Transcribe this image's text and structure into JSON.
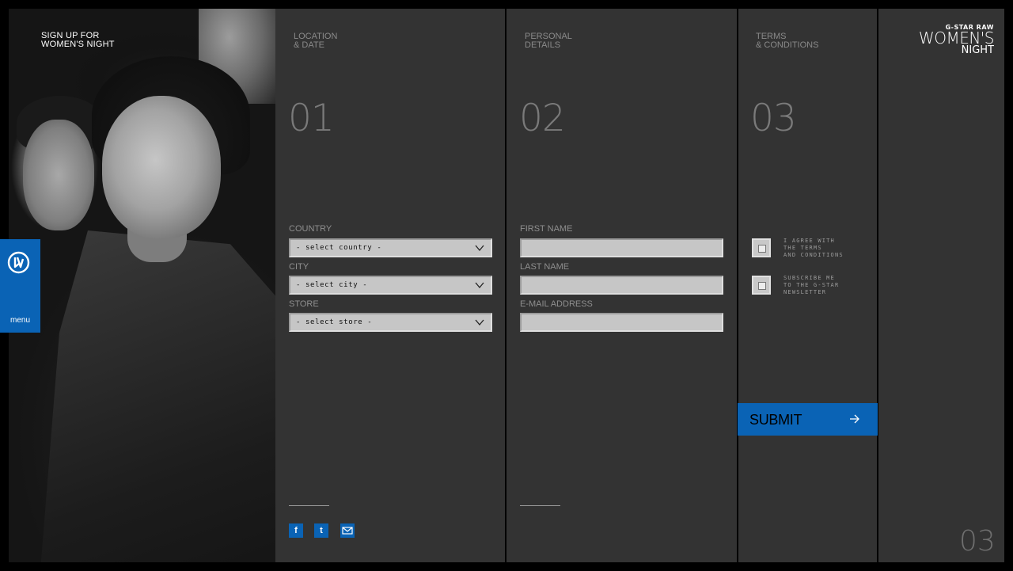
{
  "photo_panel": {
    "title_line1": "SIGN UP FOR",
    "title_line2": "WOMEN'S NIGHT"
  },
  "menu": {
    "label": "menu",
    "icon": "g-star-logo-icon",
    "color": "#0a63b5"
  },
  "steps": [
    {
      "head_line1": "LOCATION",
      "head_line2": "& DATE",
      "number": "01"
    },
    {
      "head_line1": "PERSONAL",
      "head_line2": "DETAILS",
      "number": "02"
    },
    {
      "head_line1": "TERMS",
      "head_line2": "& CONDITIONS",
      "number": "03"
    }
  ],
  "location": {
    "country_label": "COUNTRY",
    "country_value": "- select country -",
    "city_label": "CITY",
    "city_value": "- select city -",
    "store_label": "STORE",
    "store_value": "- select store -"
  },
  "personal": {
    "first_name_label": "FIRST NAME",
    "first_name_value": "",
    "last_name_label": "LAST NAME",
    "last_name_value": "",
    "email_label": "E-MAIL ADDRESS",
    "email_value": ""
  },
  "terms": {
    "agree_line1": "I AGREE WITH",
    "agree_line2": "THE TERMS",
    "agree_line3": "AND CONDITIONS",
    "subscribe_line1": "SUBSCRIBE ME",
    "subscribe_line2": "TO THE G-STAR",
    "subscribe_line3": "NEWSLETTER",
    "agree_checked": false,
    "subscribe_checked": false
  },
  "submit": {
    "label": "SUBMIT",
    "icon": "arrow-right-icon"
  },
  "social": [
    {
      "icon": "facebook-icon",
      "glyph": "f"
    },
    {
      "icon": "twitter-icon",
      "glyph": "t"
    },
    {
      "icon": "mail-icon",
      "glyph": ""
    }
  ],
  "brand": {
    "line1": "G-STAR RAW",
    "line2": "WOMEN'S",
    "line3": "NIGHT"
  },
  "page_number": "03",
  "colors": {
    "accent": "#0a63b5",
    "panel": "#333333",
    "background": "#000000"
  }
}
